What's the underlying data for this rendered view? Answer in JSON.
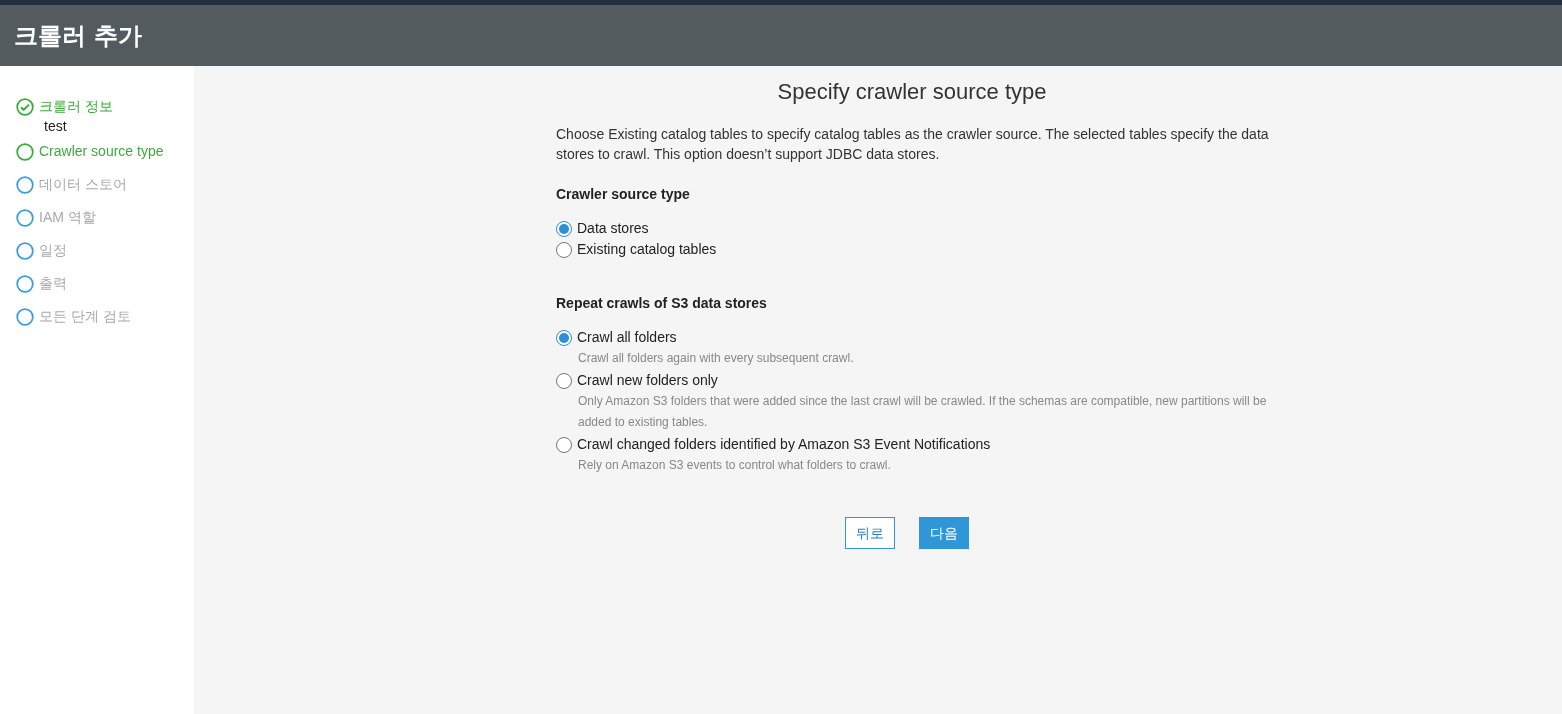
{
  "header": {
    "title": "크롤러 추가"
  },
  "steps": [
    {
      "label": "크롤러 정보",
      "kind": "done",
      "detail": "test"
    },
    {
      "label": "Crawler source type",
      "kind": "current"
    },
    {
      "label": "데이터 스토어",
      "kind": "pending"
    },
    {
      "label": "IAM 역할",
      "kind": "pending"
    },
    {
      "label": "일정",
      "kind": "pending"
    },
    {
      "label": "출력",
      "kind": "pending"
    },
    {
      "label": "모든 단계 검토",
      "kind": "pending"
    }
  ],
  "page": {
    "title": "Specify crawler source type",
    "description": "Choose Existing catalog tables to specify catalog tables as the crawler source. The selected tables specify the data stores to crawl. This option doesn’t support JDBC data stores."
  },
  "groups": [
    {
      "heading": "Crawler source type",
      "options": [
        {
          "label": "Data stores",
          "selected": true
        },
        {
          "label": "Existing catalog tables",
          "selected": false
        }
      ]
    },
    {
      "heading": "Repeat crawls of S3 data stores",
      "options": [
        {
          "label": "Crawl all folders",
          "selected": true,
          "hint": "Crawl all folders again with every subsequent crawl."
        },
        {
          "label": "Crawl new folders only",
          "selected": false,
          "hint": "Only Amazon S3 folders that were added since the last crawl will be crawled. If the schemas are compatible, new partitions will be added to existing tables."
        },
        {
          "label": "Crawl changed folders identified by Amazon S3 Event Notifications",
          "selected": false,
          "hint": "Rely on Amazon S3 events to control what folders to crawl."
        }
      ]
    }
  ],
  "buttons": [
    {
      "label": "뒤로",
      "kind": "secondary"
    },
    {
      "label": "다음",
      "kind": "primary"
    }
  ]
}
